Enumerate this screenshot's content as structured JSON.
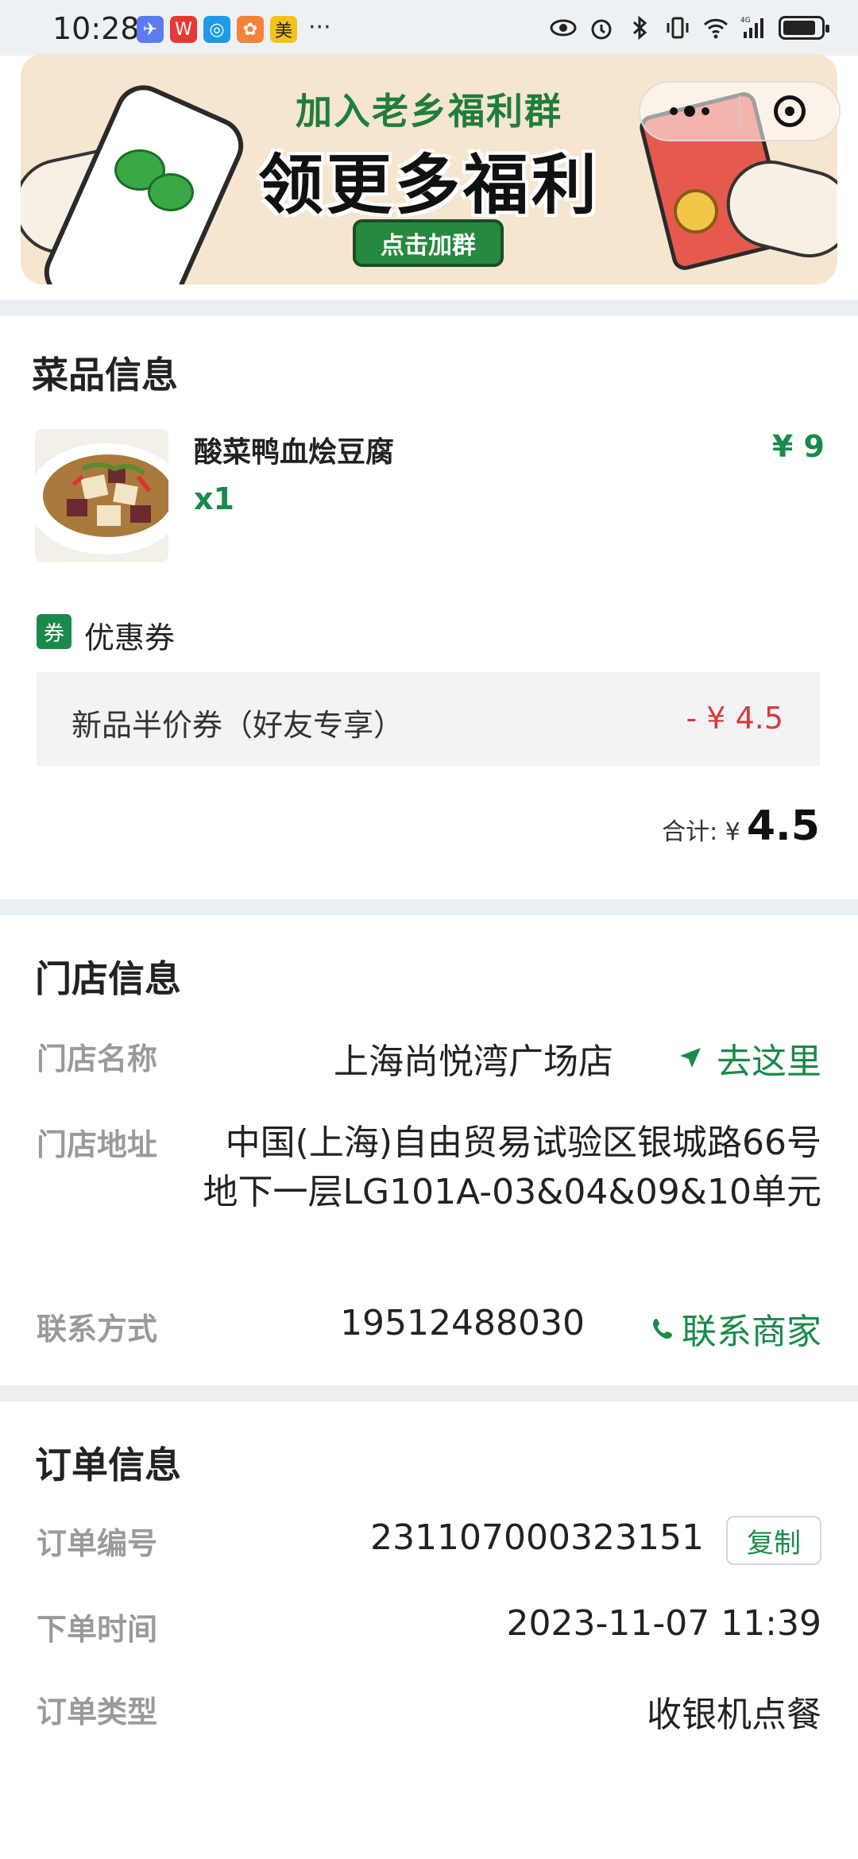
{
  "status_bar": {
    "time": "10:28",
    "apps": [
      {
        "icon": "feishu-app-icon",
        "glyph": "✈",
        "color": "#5b7bef"
      },
      {
        "icon": "wps-app-icon",
        "glyph": "W",
        "color": "#e53935"
      },
      {
        "icon": "maps-app-icon",
        "glyph": "◎",
        "color": "#1e9be8"
      },
      {
        "icon": "photo-app-icon",
        "glyph": "✿",
        "color": "#f2833a"
      },
      {
        "icon": "meituan-app-icon",
        "glyph": "美",
        "color": "#f4c21c"
      }
    ],
    "more": "···",
    "network": "4G"
  },
  "banner": {
    "title_line1": "加入老乡福利群",
    "title_line2": "领更多福利",
    "button_label": "点击加群"
  },
  "dish_section": {
    "title": "菜品信息",
    "dish_name": "酸菜鸭血烩豆腐",
    "quantity": "x1",
    "price": "¥ 9"
  },
  "coupon": {
    "badge": "券",
    "label": "优惠券",
    "name": "新品半价券（好友专享）",
    "discount": "- ¥ 4.5"
  },
  "total": {
    "label": "合计: ¥",
    "value": "4.5"
  },
  "store_section": {
    "title": "门店信息",
    "name_label": "门店名称",
    "name_value": "上海尚悦湾广场店",
    "navigate_label": "去这里",
    "address_label": "门店地址",
    "address_value": "中国(上海)自由贸易试验区银城路66号地下一层LG101A-03&04&09&10单元",
    "contact_label": "联系方式",
    "contact_value": "19512488030",
    "contact_link": "联系商家"
  },
  "order_section": {
    "title": "订单信息",
    "number_label": "订单编号",
    "number_value": "231107000323151",
    "copy_label": "复制",
    "time_label": "下单时间",
    "time_value": "2023-11-07 11:39",
    "type_label": "订单类型",
    "type_value": "收银机点餐"
  },
  "colors": {
    "accent_green": "#1a8a4a",
    "discount_red": "#d63a3a",
    "divider": "#e9eff2"
  }
}
